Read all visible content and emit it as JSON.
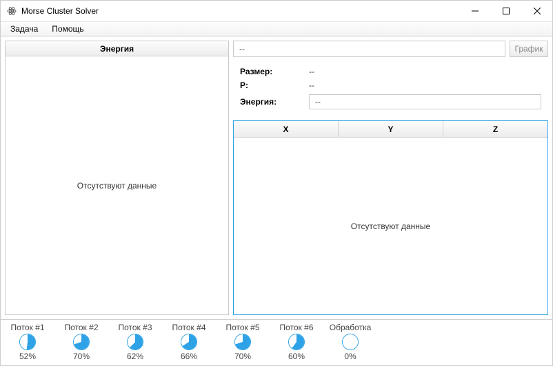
{
  "window": {
    "title": "Morse Cluster Solver"
  },
  "menu": {
    "task": "Задача",
    "help": "Помощь"
  },
  "left": {
    "header": "Энергия",
    "empty": "Отсутствуют данные"
  },
  "right": {
    "name_value": "--",
    "graph_btn": "График",
    "size_label": "Размер:",
    "size_value": "--",
    "p_label": "P:",
    "p_value": "--",
    "energy_label": "Энергия:",
    "energy_value": "--"
  },
  "table": {
    "cols": {
      "x": "X",
      "y": "Y",
      "z": "Z"
    },
    "empty": "Отсутствуют данные"
  },
  "threads": [
    {
      "label": "Поток #1",
      "pct": 52,
      "pct_text": "52%"
    },
    {
      "label": "Поток #2",
      "pct": 70,
      "pct_text": "70%"
    },
    {
      "label": "Поток #3",
      "pct": 62,
      "pct_text": "62%"
    },
    {
      "label": "Поток #4",
      "pct": 66,
      "pct_text": "66%"
    },
    {
      "label": "Поток #5",
      "pct": 70,
      "pct_text": "70%"
    },
    {
      "label": "Поток #6",
      "pct": 60,
      "pct_text": "60%"
    },
    {
      "label": "Обработка",
      "pct": 0,
      "pct_text": "0%"
    }
  ]
}
